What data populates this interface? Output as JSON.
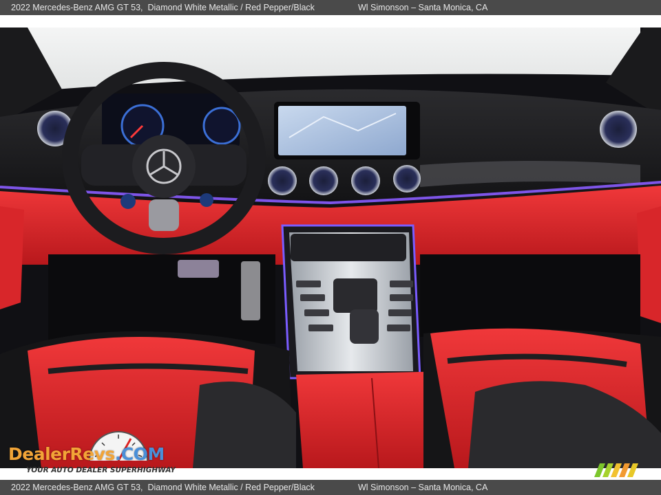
{
  "header": {
    "caption": "2022 Mercedes-Benz AMG GT 53,  Diamond White Metallic / Red Pepper/Black",
    "dealer": "Wl Simonson – Santa Monica, CA"
  },
  "footer": {
    "caption": "2022 Mercedes-Benz AMG GT 53,  Diamond White Metallic / Red Pepper/Black",
    "dealer": "Wl Simonson – Santa Monica, CA"
  },
  "watermark": {
    "brand_part1": "DealerRevs",
    "brand_part2": ".COM",
    "tagline": "YOUR AUTO DEALER SUPERHIGHWAY"
  },
  "colors": {
    "bar_bg": "#4a4a4a",
    "interior_red": "#e0282c",
    "ambient_light": "#7a4cff",
    "brand_orange": "#f2a437",
    "brand_blue": "#4a8fd8"
  },
  "photo": {
    "subject": "car interior dashboard photo"
  }
}
